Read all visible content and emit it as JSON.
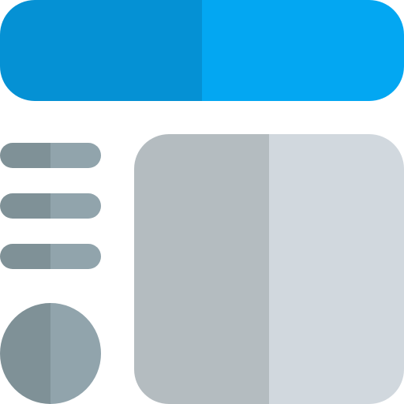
{
  "icon": {
    "name": "layout-template-icon",
    "colors": {
      "header_dark": "#0591D4",
      "header_light": "#03A7F2",
      "line_dark": "#7F9197",
      "line_light": "#91A4AC",
      "panel_dark": "#B4BCC0",
      "panel_light": "#D1D8DE"
    },
    "parts": {
      "header": "header-bar",
      "menu_lines": [
        "menu-line",
        "menu-line",
        "menu-line"
      ],
      "avatar": "avatar-circle",
      "content": "content-panel"
    }
  }
}
